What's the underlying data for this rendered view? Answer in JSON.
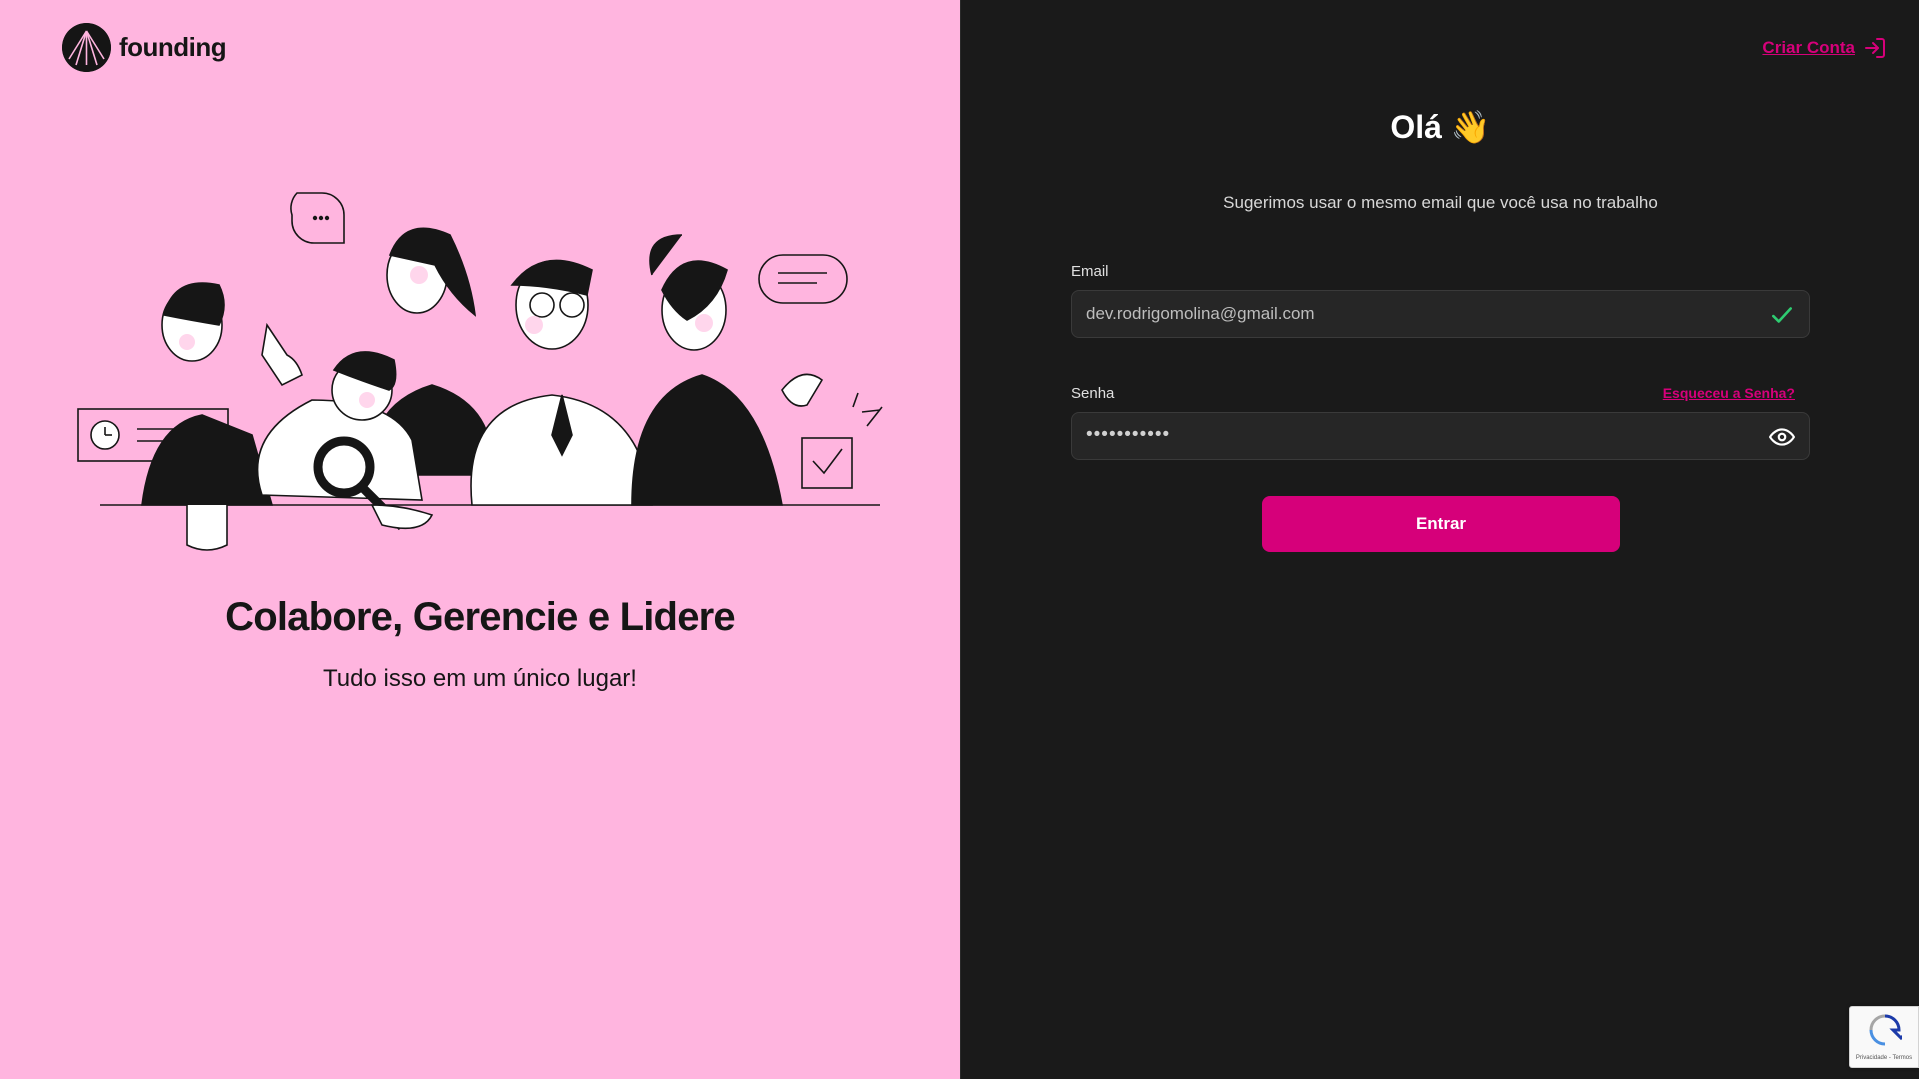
{
  "brand": {
    "name": "founding",
    "icon": "founding-logo"
  },
  "hero": {
    "title": "Colabore, Gerencie e Lidere",
    "subtitle": "Tudo isso em um único lugar!"
  },
  "header": {
    "signup_label": "Criar Conta",
    "signup_icon": "sign-in-icon"
  },
  "login": {
    "greeting": "Olá 👋",
    "hint": "Sugerimos usar o mesmo email que você usa no trabalho",
    "email_label": "Email",
    "email_value": "dev.rodrigomolina@gmail.com",
    "password_label": "Senha",
    "forgot_label": "Esqueceu a Senha?",
    "password_mask": "•••••••••••",
    "submit_label": "Entrar"
  },
  "recaptcha": {
    "text": "Privacidade - Termos"
  },
  "colors": {
    "left_bg": "#ffb5df",
    "right_bg": "#1a1a1a",
    "accent": "#d6007a",
    "valid": "#2ecc71"
  }
}
